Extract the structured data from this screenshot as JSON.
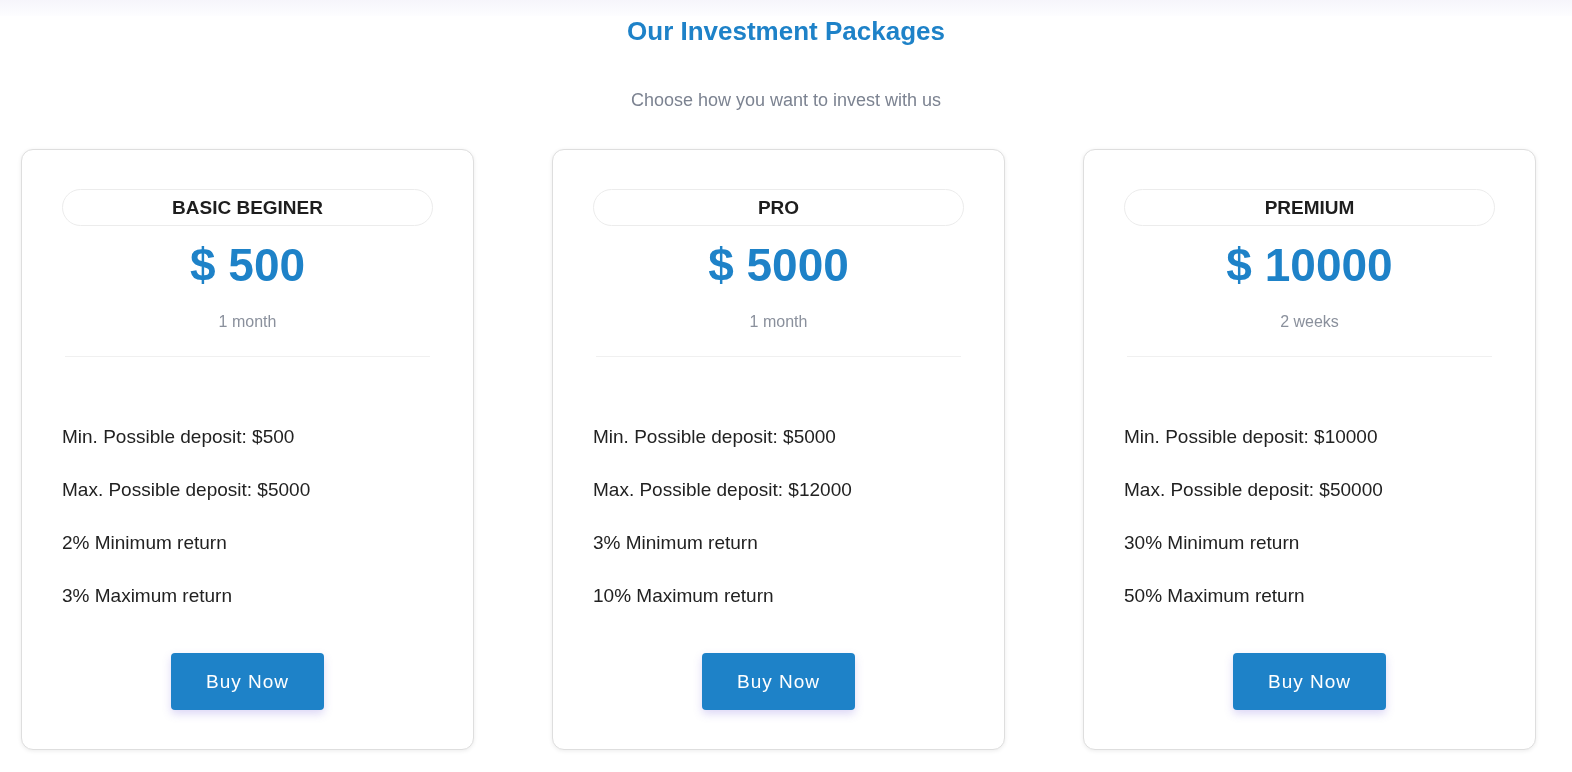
{
  "header": {
    "title": "Our Investment Packages",
    "subtitle": "Choose how you want to invest with us"
  },
  "packages": [
    {
      "name": "BASIC BEGINER",
      "price": "$ 500",
      "duration": "1 month",
      "features": [
        "Min. Possible deposit: $500",
        "Max. Possible deposit: $5000",
        "2% Minimum return",
        "3% Maximum return"
      ],
      "button": "Buy Now"
    },
    {
      "name": "PRO",
      "price": "$ 5000",
      "duration": "1 month",
      "features": [
        "Min. Possible deposit: $5000",
        "Max. Possible deposit: $12000",
        "3% Minimum return",
        "10% Maximum return"
      ],
      "button": "Buy Now"
    },
    {
      "name": "PREMIUM",
      "price": "$ 10000",
      "duration": "2 weeks",
      "features": [
        "Min. Possible deposit: $10000",
        "Max. Possible deposit: $50000",
        "30% Minimum return",
        "50% Maximum return"
      ],
      "button": "Buy Now"
    }
  ]
}
